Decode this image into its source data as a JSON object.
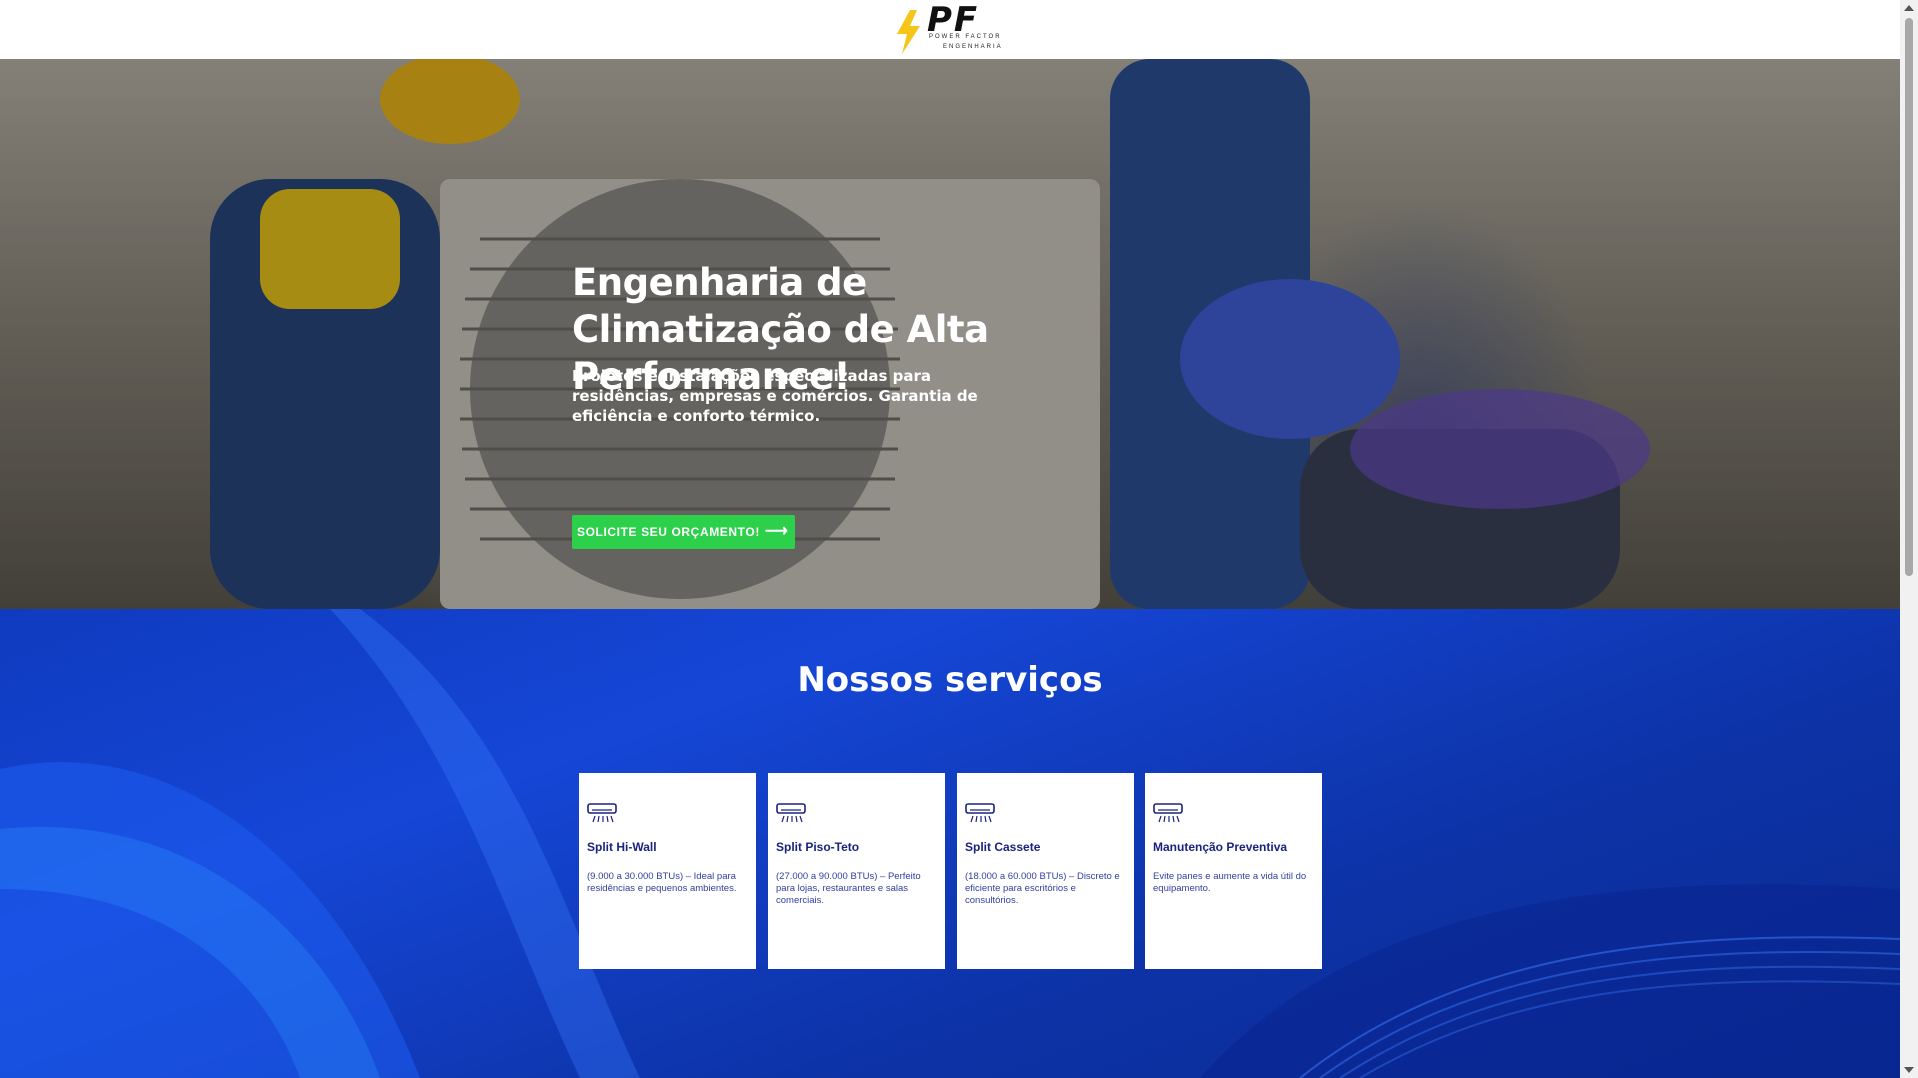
{
  "header": {
    "logo_text": "PF",
    "logo_line1": "POWER FACTOR",
    "logo_line2": "ENGENHARIA"
  },
  "hero": {
    "title": "Engenharia de Climatização de Alta Performance!",
    "subtitle": "Projetos e Instalações especializadas para residências, empresas e comércios. Garantia de eficiência e conforto térmico.",
    "cta_label": "SOLICITE SEU ORÇAMENTO!",
    "cta_icon": "arrow-right-icon"
  },
  "services": {
    "title": "Nossos serviços",
    "cards": [
      {
        "icon": "air-conditioner-icon",
        "title": "Split Hi-Wall",
        "description": "(9.000 a 30.000 BTUs) – Ideal para residências e pequenos ambientes."
      },
      {
        "icon": "air-conditioner-icon",
        "title": "Split Piso-Teto",
        "description": "(27.000 a 90.000 BTUs) – Perfeito para lojas, restaurantes e salas comerciais."
      },
      {
        "icon": "air-conditioner-icon",
        "title": "Split Cassete",
        "description": "(18.000 a 60.000 BTUs) – Discreto e eficiente para escritórios e consultórios."
      },
      {
        "icon": "air-conditioner-icon",
        "title": "Manutenção Preventiva",
        "description": "Evite panes e aumente a vida útil do equipamento."
      }
    ]
  },
  "colors": {
    "cta": "#2dd04b",
    "services_bg": "#1546d6",
    "card_title": "#1a237e",
    "logo_bolt": "#f5c518"
  }
}
